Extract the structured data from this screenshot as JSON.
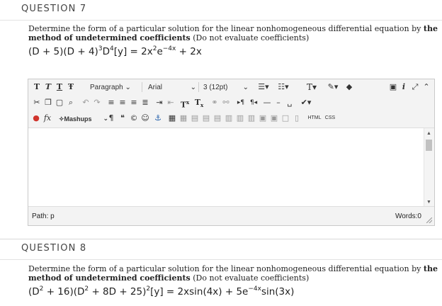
{
  "q7": {
    "title": "QUESTION 7",
    "prompt_pre": "Determine the form of a particular solution for the linear nonhomogeneous differential equation by ",
    "prompt_bold": "the method of undetermined coefficients",
    "prompt_post": " (Do not evaluate coefficients)",
    "eq_a": "(D + 5)(D + 4)",
    "eq_b": "3",
    "eq_c": "D",
    "eq_d": "4",
    "eq_e": "[y] = 2x",
    "eq_f": "2",
    "eq_g": "e",
    "eq_h": "−4x",
    "eq_i": " + 2x"
  },
  "editor": {
    "format_tbtn": [
      "T",
      "T",
      "T",
      "Ŧ"
    ],
    "paragraph": "Paragraph",
    "font": "Arial",
    "size": "3 (12pt)",
    "mashups": "Mashups",
    "html_label": "HTML",
    "css_label": "CSS",
    "path_label": "Path: p",
    "words_label": "Words:0"
  },
  "q8": {
    "title": "QUESTION 8",
    "prompt_pre": "Determine the form of a particular solution for the linear nonhomogeneous differential equation by ",
    "prompt_bold": "the method of undetermined coefficients",
    "prompt_post": " (Do not evaluate coefficients)",
    "eq_a": "(D",
    "eq_b": "2",
    "eq_c": " + 16)(D",
    "eq_d": "2",
    "eq_e": " + 8D + 25)",
    "eq_f": "2",
    "eq_g": "[y] = 2xsin(4x) + 5e",
    "eq_h": "−4x",
    "eq_i": "sin(3x)"
  }
}
